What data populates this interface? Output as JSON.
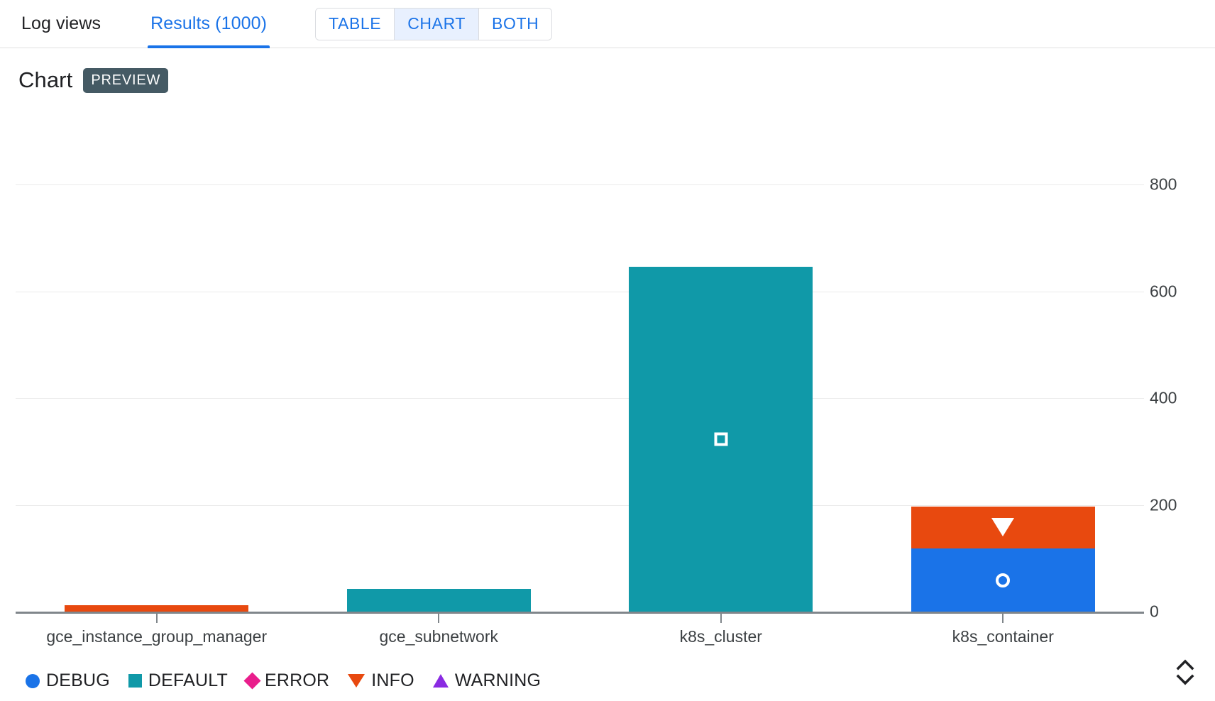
{
  "tabs": [
    {
      "label": "Log views",
      "active": false
    },
    {
      "label": "Results (1000)",
      "active": true
    }
  ],
  "view_toggle": {
    "options": [
      {
        "label": "TABLE",
        "selected": false
      },
      {
        "label": "CHART",
        "selected": true
      },
      {
        "label": "BOTH",
        "selected": false
      }
    ]
  },
  "chart_header": {
    "title": "Chart",
    "badge": "PREVIEW"
  },
  "icons": {
    "expand_handle": "chevron-up-down-icon"
  },
  "colors": {
    "debug": "#1a73e8",
    "default": "#1099a8",
    "error": "#e91e8c",
    "info": "#e8490f",
    "warning": "#8a2be2",
    "accent": "#1a73e8",
    "badge_bg": "#455a64",
    "selected_toggle_bg": "#e8f0fe",
    "axis": "#80868b",
    "gridline": "#ebebeb"
  },
  "chart_data": {
    "type": "bar",
    "stacked": true,
    "title": "Chart",
    "xlabel": "",
    "ylabel": "",
    "ylim": [
      0,
      800
    ],
    "yticks": [
      0,
      200,
      400,
      600,
      800
    ],
    "grid": true,
    "legend_position": "bottom-left",
    "categories": [
      "gce_instance_group_manager",
      "gce_subnetwork",
      "k8s_cluster",
      "k8s_container"
    ],
    "series": [
      {
        "name": "DEBUG",
        "color": "#1a73e8",
        "marker": "circle",
        "values": [
          0,
          0,
          0,
          118
        ]
      },
      {
        "name": "DEFAULT",
        "color": "#1099a8",
        "marker": "square",
        "values": [
          0,
          43,
          646,
          0
        ]
      },
      {
        "name": "ERROR",
        "color": "#e91e8c",
        "marker": "diamond",
        "values": [
          0,
          0,
          0,
          0
        ]
      },
      {
        "name": "INFO",
        "color": "#e8490f",
        "marker": "triangle-down",
        "values": [
          12,
          0,
          0,
          79
        ]
      },
      {
        "name": "WARNING",
        "color": "#8a2be2",
        "marker": "triangle-up",
        "values": [
          0,
          0,
          0,
          0
        ]
      }
    ]
  }
}
